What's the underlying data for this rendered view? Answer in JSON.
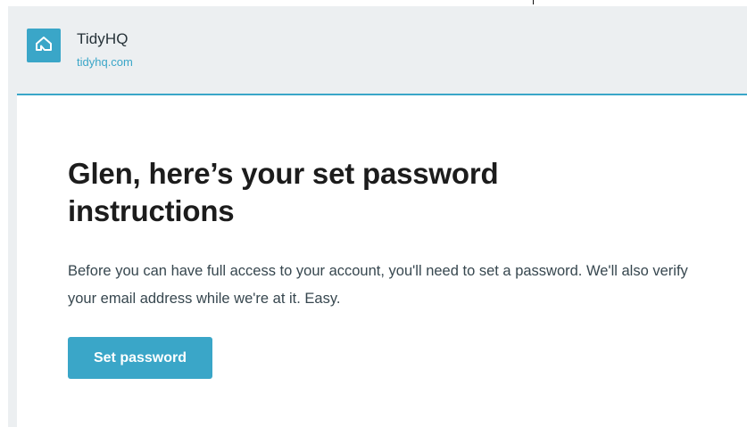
{
  "header": {
    "brand_name": "TidyHQ",
    "brand_url": "tidyhq.com",
    "logo_icon": "tidyhq-house-logo-icon"
  },
  "email": {
    "headline": "Glen, here’s your set password instructions",
    "body": "Before you can have full access to your account, you'll need to set a password. We'll also verify your email address while we're at it. Easy.",
    "button_label": "Set password"
  },
  "colors": {
    "accent": "#3aa6c8",
    "header_bg": "#eceff1",
    "card_bg": "#ffffff",
    "headline_text": "#1c1c1c",
    "body_text": "#37474f"
  }
}
